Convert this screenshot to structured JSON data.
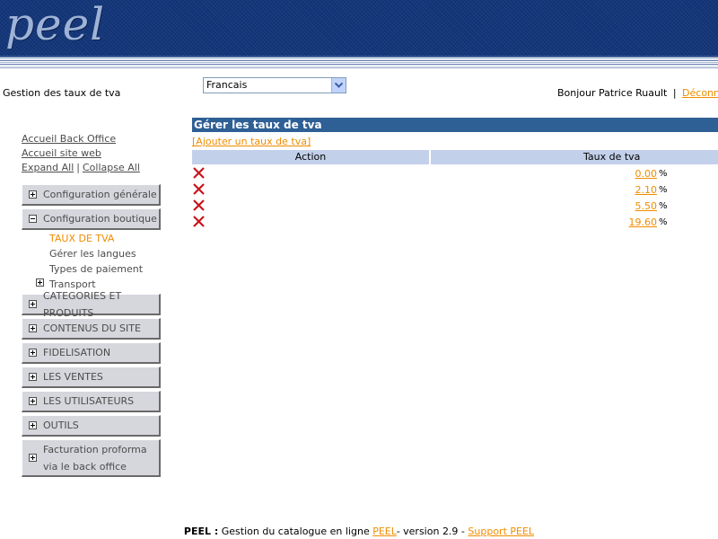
{
  "header": {
    "logo_text": "peel"
  },
  "page_heading": "Gestion des taux de tva",
  "language_select": {
    "selected": "Francais"
  },
  "greeting": {
    "text": "Bonjour Patrice Ruault",
    "separator": "|",
    "logout": "Déconnexion"
  },
  "nav": {
    "back_office_home": "Accueil Back Office",
    "site_home": "Accueil site web",
    "expand_all": "Expand All",
    "collapse_all": "Collapse All",
    "separator": "|",
    "menu": [
      {
        "label": "Configuration générale"
      },
      {
        "label": "Configuration boutique"
      },
      {
        "label": "CATEGORIES ET PRODUITS"
      },
      {
        "label": "CONTENUS DU SITE"
      },
      {
        "label": "FIDELISATION"
      },
      {
        "label": "LES VENTES"
      },
      {
        "label": "LES UTILISATEURS"
      },
      {
        "label": "OUTILS"
      },
      {
        "label": "Facturation proforma via le back office"
      }
    ],
    "submenu": [
      {
        "label": "TAUX DE TVA"
      },
      {
        "label": "Gérer les langues"
      },
      {
        "label": "Types de paiement"
      },
      {
        "label": "Transport"
      }
    ]
  },
  "panel": {
    "title": "Gérer les taux de tva",
    "add_link": "[Ajouter un taux de tva]",
    "columns": [
      "Action",
      "Taux de tva"
    ],
    "rows": [
      {
        "rate": "0.00",
        "unit": "%"
      },
      {
        "rate": "2.10",
        "unit": "%"
      },
      {
        "rate": "5.50",
        "unit": "%"
      },
      {
        "rate": "19.60",
        "unit": "%"
      }
    ]
  },
  "footer": {
    "brand": "PEEL :",
    "text": "Gestion du catalogue en ligne",
    "peel_link": "PEEL",
    "version": "- version 2.9 -",
    "support_link": "Support PEEL"
  },
  "colors": {
    "banner": "#13367a",
    "panel_title_bg": "#2e5f95",
    "table_header_bg": "#c3d0ea",
    "link": "#ef8d00",
    "menu_button_bg": "#d6d7dd"
  },
  "icons": {
    "delete": "red-x-icon",
    "dropdown": "chevron-down-icon",
    "expand": "plus-box-icon",
    "collapse": "minus-box-icon"
  }
}
